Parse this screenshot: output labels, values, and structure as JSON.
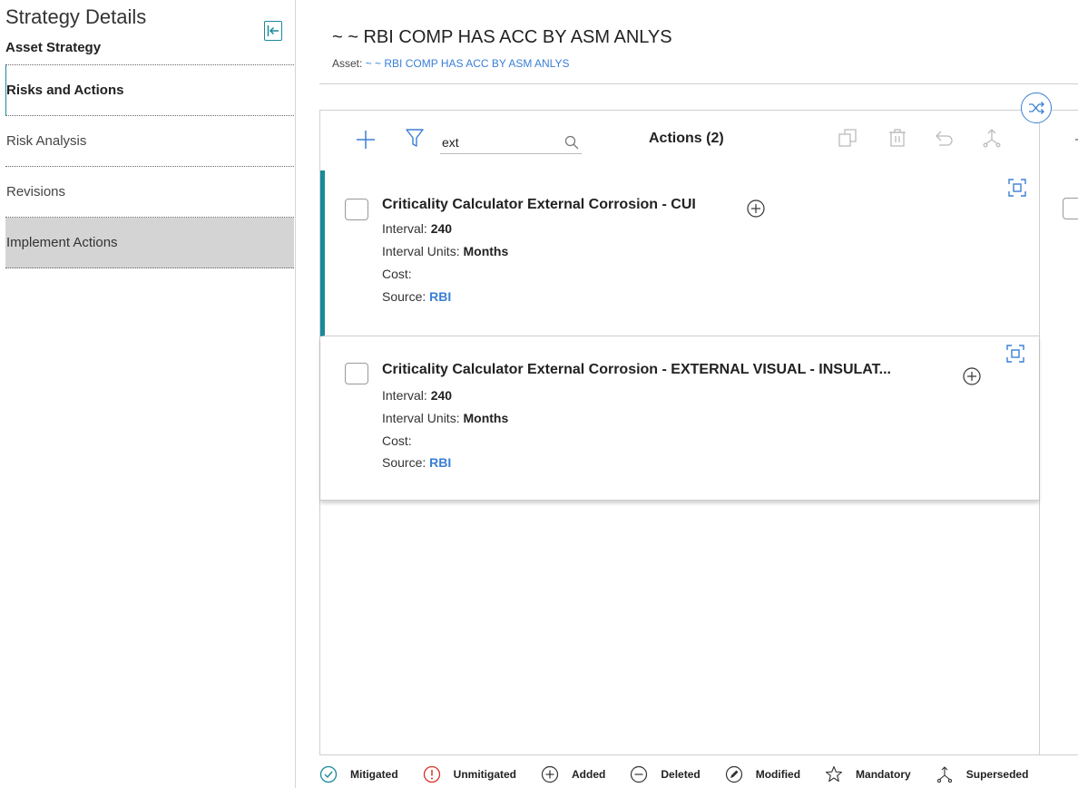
{
  "sidebar": {
    "title": "Strategy Details",
    "subtitle": "Asset Strategy",
    "items": [
      {
        "label": "Risks and Actions"
      },
      {
        "label": "Risk Analysis"
      },
      {
        "label": "Revisions"
      },
      {
        "label": "Implement Actions"
      }
    ]
  },
  "header": {
    "title": "~ ~ RBI COMP HAS ACC BY ASM ANLYS",
    "asset_label": "Asset:",
    "asset_link": "~ ~ RBI COMP HAS ACC BY ASM ANLYS"
  },
  "toolbar": {
    "search_value": "ext",
    "title": "Actions (2)"
  },
  "actions": [
    {
      "title": "Criticality Calculator External Corrosion - CUI",
      "interval_label": "Interval:",
      "interval": "240",
      "units_label": "Interval Units:",
      "units": "Months",
      "cost_label": "Cost:",
      "source_label": "Source:",
      "source": "RBI"
    },
    {
      "title": "Criticality Calculator External Corrosion - EXTERNAL VISUAL - INSULAT...",
      "interval_label": "Interval:",
      "interval": "240",
      "units_label": "Interval Units:",
      "units": "Months",
      "cost_label": "Cost:",
      "source_label": "Source:",
      "source": "RBI"
    }
  ],
  "legend": [
    {
      "label": "Mitigated",
      "icon": "check-circle-icon",
      "color": "#1a8a9a"
    },
    {
      "label": "Unmitigated",
      "icon": "exclamation-circle-icon",
      "color": "#d9342b"
    },
    {
      "label": "Added",
      "icon": "plus-circle-icon",
      "color": "#333333"
    },
    {
      "label": "Deleted",
      "icon": "minus-circle-icon",
      "color": "#333333"
    },
    {
      "label": "Modified",
      "icon": "pencil-circle-icon",
      "color": "#333333"
    },
    {
      "label": "Mandatory",
      "icon": "star-icon",
      "color": "#333333"
    },
    {
      "label": "Superseded",
      "icon": "supersede-icon",
      "color": "#333333"
    }
  ],
  "colors": {
    "accent": "#1a8a9a",
    "link": "#3a7fd5",
    "selected_bg": "#d4d4d4",
    "error": "#d9342b"
  }
}
